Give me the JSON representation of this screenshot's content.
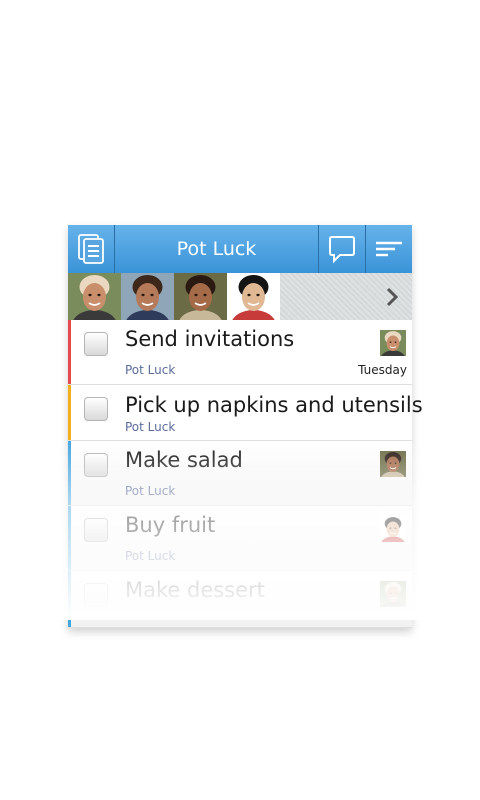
{
  "header": {
    "title": "Pot Luck"
  },
  "people": [
    {
      "name": "person-1",
      "skin": "#c98f6c",
      "hair": "#ead9c0",
      "bg": "#7a8b5c",
      "shirt": "#3a3a3a"
    },
    {
      "name": "person-2",
      "skin": "#b57a5a",
      "hair": "#3d261a",
      "bg": "#8fa5b8",
      "shirt": "#2f3b5a"
    },
    {
      "name": "person-3",
      "skin": "#a56a48",
      "hair": "#2a1a12",
      "bg": "#6b6b45",
      "shirt": "#c8b89a"
    },
    {
      "name": "person-4",
      "skin": "#e0b894",
      "hair": "#141414",
      "bg": "#ffffff",
      "shirt": "#c83b3b"
    }
  ],
  "tasks": [
    {
      "label": "Send invitations",
      "list": "Pot Luck",
      "date": "Tuesday",
      "color": "#e5484d",
      "assignee": true
    },
    {
      "label": "Pick up napkins and utensils",
      "list": "Pot Luck",
      "date": "",
      "color": "#f2b01e",
      "assignee": false
    },
    {
      "label": "Make salad",
      "list": "Pot Luck",
      "date": "",
      "color": "#45a6df",
      "assignee": true
    },
    {
      "label": "Buy fruit",
      "list": "Pot Luck",
      "date": "",
      "color": "#45a6df",
      "assignee": true
    },
    {
      "label": "Make dessert",
      "list": "",
      "date": "",
      "color": "#45a6df",
      "assignee": true
    }
  ]
}
